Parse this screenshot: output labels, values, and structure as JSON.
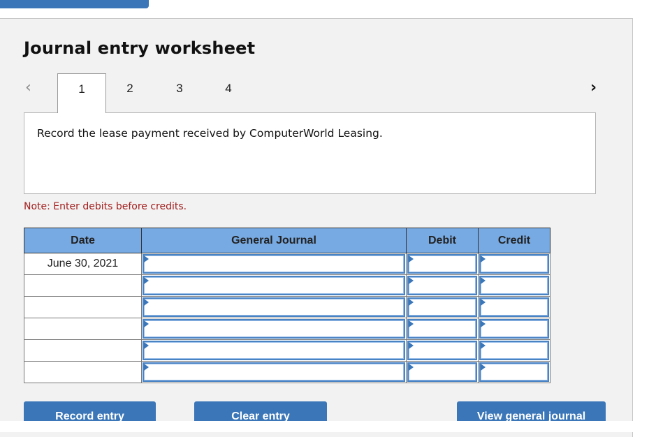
{
  "header": {
    "title": "Journal entry worksheet"
  },
  "pagination": {
    "prev_icon": "chevron-left-icon",
    "next_icon": "chevron-right-icon",
    "tabs": [
      {
        "label": "1",
        "active": true
      },
      {
        "label": "2",
        "active": false
      },
      {
        "label": "3",
        "active": false
      },
      {
        "label": "4",
        "active": false
      }
    ]
  },
  "prompt": {
    "text": "Record the lease payment received by ComputerWorld Leasing."
  },
  "note": "Note: Enter debits before credits.",
  "journal": {
    "columns": [
      "Date",
      "General Journal",
      "Debit",
      "Credit"
    ],
    "rows": [
      {
        "date": "June 30, 2021",
        "account": "",
        "debit": "",
        "credit": ""
      },
      {
        "date": "",
        "account": "",
        "debit": "",
        "credit": ""
      },
      {
        "date": "",
        "account": "",
        "debit": "",
        "credit": ""
      },
      {
        "date": "",
        "account": "",
        "debit": "",
        "credit": ""
      },
      {
        "date": "",
        "account": "",
        "debit": "",
        "credit": ""
      },
      {
        "date": "",
        "account": "",
        "debit": "",
        "credit": ""
      }
    ]
  },
  "buttons": {
    "record": "Record entry",
    "clear": "Clear entry",
    "view": "View general journal"
  },
  "colors": {
    "accent": "#3a76b8",
    "header_bg": "#77a9e2",
    "note": "#a31d1d"
  }
}
